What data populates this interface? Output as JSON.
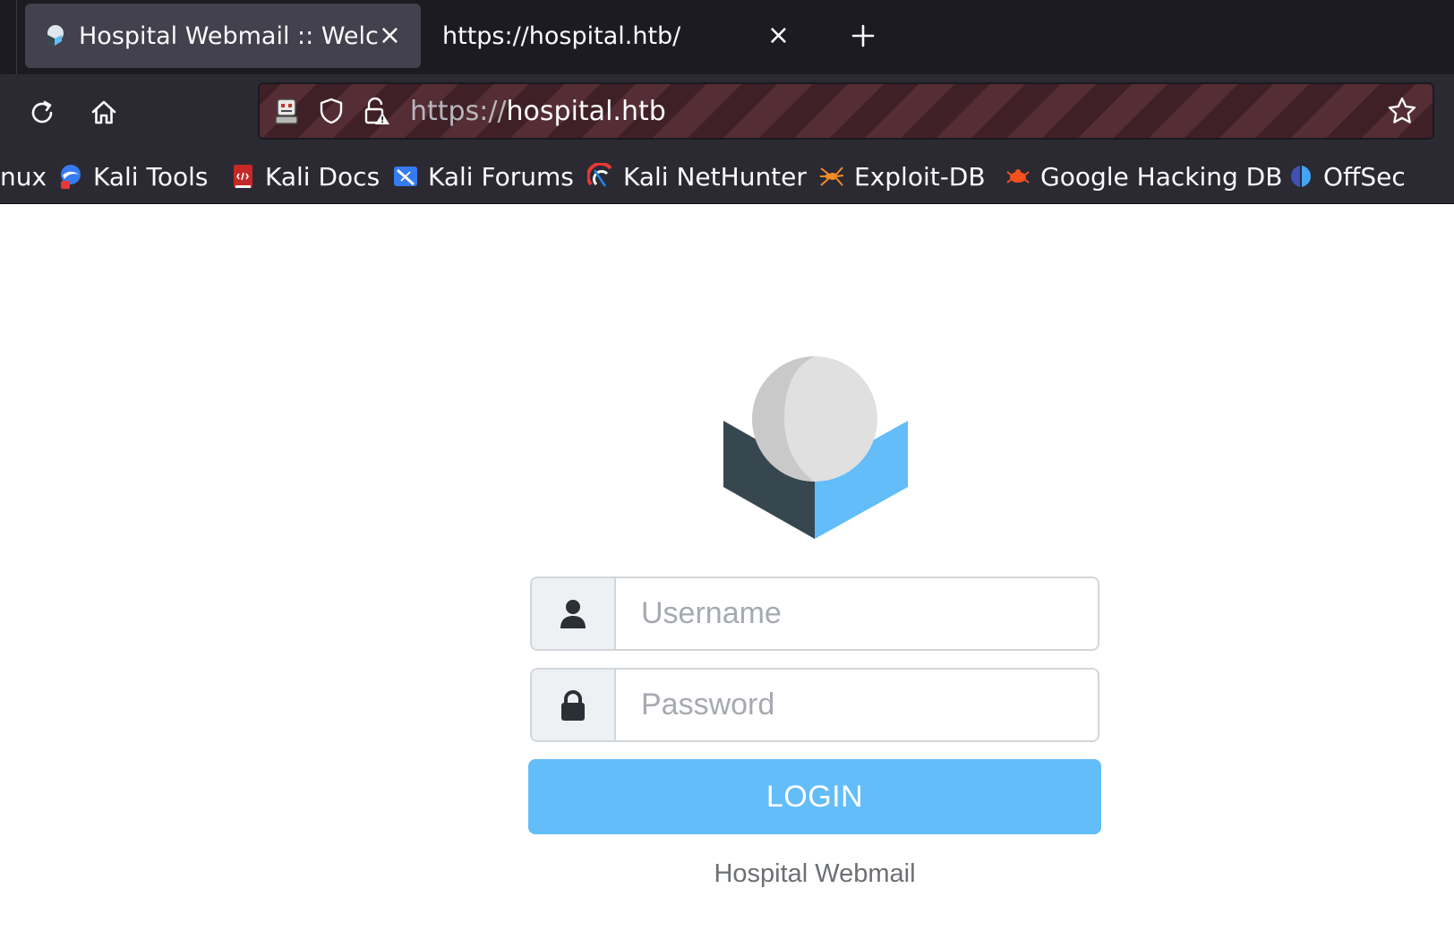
{
  "browser": {
    "tabs": [
      {
        "title": "Hospital Webmail :: Welcome",
        "active": true,
        "icon": "roundcube-favicon"
      },
      {
        "title": "https://hospital.htb/",
        "active": false,
        "icon": "none"
      }
    ],
    "close_glyph": "×",
    "new_tab_icon": "plus-icon",
    "url": {
      "scheme": "https://",
      "host": "hospital.htb"
    },
    "bookmarks": [
      {
        "label": "nux",
        "icon": "kali-linux-icon"
      },
      {
        "label": "Kali Tools",
        "icon": "kali-tools-icon"
      },
      {
        "label": "Kali Docs",
        "icon": "kali-docs-icon"
      },
      {
        "label": "Kali Forums",
        "icon": "kali-forums-icon"
      },
      {
        "label": "Kali NetHunter",
        "icon": "nethunter-icon"
      },
      {
        "label": "Exploit-DB",
        "icon": "exploit-db-icon"
      },
      {
        "label": "Google Hacking DB",
        "icon": "ghdb-icon"
      },
      {
        "label": "OffSec",
        "icon": "offsec-icon"
      }
    ],
    "colors": {
      "chrome": "#1c1b22",
      "toolbar": "#2b2a33",
      "text": "#fbfbfe"
    }
  },
  "login": {
    "username_placeholder": "Username",
    "password_placeholder": "Password",
    "button_label": "LOGIN",
    "footer": "Hospital Webmail",
    "colors": {
      "button": "#62bdf9",
      "addon_bg": "#eef1f4"
    }
  }
}
